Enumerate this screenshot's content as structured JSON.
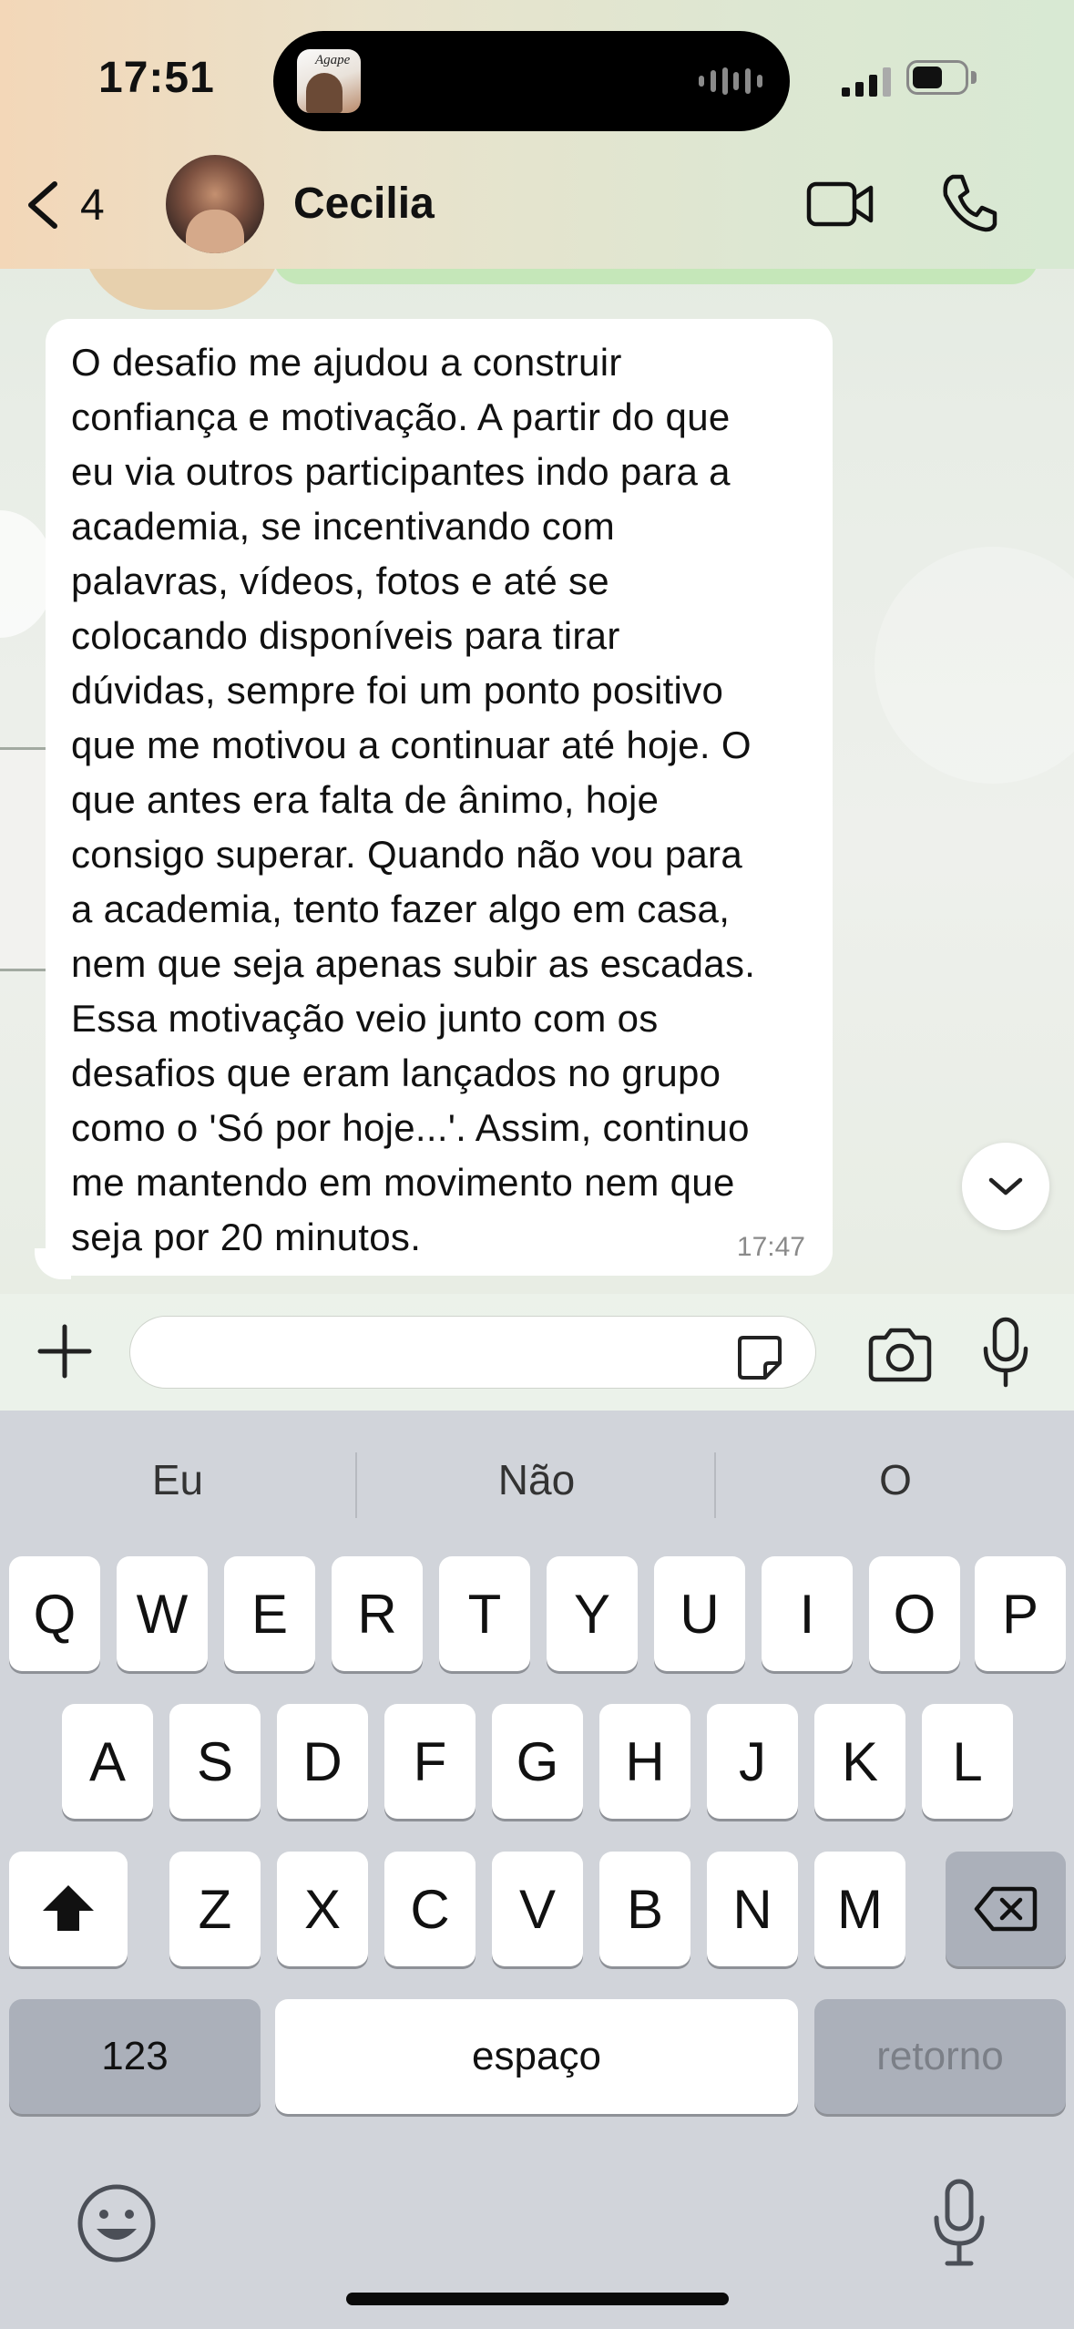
{
  "status_bar": {
    "time": "17:51",
    "island_thumb_label": "Agape"
  },
  "header": {
    "back_count": "4",
    "contact_name": "Cecilia",
    "icons": [
      "chevron-left-icon",
      "video-camera-icon",
      "phone-icon"
    ]
  },
  "message": {
    "text": "O desafio me ajudou a construir\nconfiança e motivação. A partir do que\neu via outros participantes indo para a\nacademia, se incentivando com\npalavras, vídeos, fotos e até se\ncolocando disponíveis para tirar\ndúvidas, sempre foi um ponto positivo\nque me motivou a continuar até hoje. O\nque antes era falta de ânimo, hoje\nconsigo superar. Quando não vou para\na academia, tento fazer algo em casa,\nnem que seja apenas subir as escadas.\nEssa motivação veio junto com os\ndesafios que eram lançados no grupo\ncomo o 'Só por hoje...'. Assim, continuo\nme mantendo em movimento nem que\nseja por 20 minutos.",
    "time": "17:47"
  },
  "input_bar": {
    "message_value": "",
    "icons": [
      "plus-icon",
      "sticker-icon",
      "camera-icon",
      "microphone-icon"
    ]
  },
  "keyboard": {
    "suggestions": [
      "Eu",
      "Não",
      "O"
    ],
    "row1": [
      "Q",
      "W",
      "E",
      "R",
      "T",
      "Y",
      "U",
      "I",
      "O",
      "P"
    ],
    "row2": [
      "A",
      "S",
      "D",
      "F",
      "G",
      "H",
      "J",
      "K",
      "L"
    ],
    "row3": [
      "Z",
      "X",
      "C",
      "V",
      "B",
      "N",
      "M"
    ],
    "numbers_label": "123",
    "space_label": "espaço",
    "return_label": "retorno"
  },
  "colors": {
    "bubble": "#ffffff",
    "keyboard_bg": "#d1d4da",
    "key_dark": "#abb0ba"
  }
}
